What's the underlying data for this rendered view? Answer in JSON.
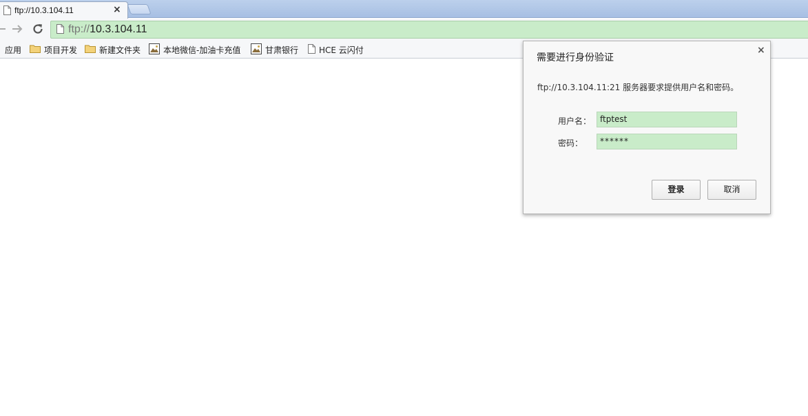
{
  "tab": {
    "title": "ftp://10.3.104.11"
  },
  "omnibox": {
    "scheme": "ftp://",
    "host": "10.3.104.11"
  },
  "bookmarks": [
    {
      "label": "应用",
      "icon": "apps-icon"
    },
    {
      "label": "项目开发",
      "icon": "folder-icon"
    },
    {
      "label": "新建文件夹",
      "icon": "folder-icon"
    },
    {
      "label": "本地微信-加油卡充值",
      "icon": "image-icon"
    },
    {
      "label": "甘肃银行",
      "icon": "image-icon"
    },
    {
      "label": "HCE 云闪付",
      "icon": "page-icon"
    }
  ],
  "dialog": {
    "title": "需要进行身份验证",
    "close": "×",
    "message": "ftp://10.3.104.11:21 服务器要求提供用户名和密码。",
    "username_label": "用户名：",
    "password_label": "密码：",
    "username_value": "ftptest",
    "password_value": "******",
    "login_label": "登录",
    "cancel_label": "取消"
  },
  "colors": {
    "tabstrip": "#a7bfe3",
    "omnibox_bg": "#c9ecc9",
    "dialog_bg": "#f8f8f8",
    "input_bg": "#c9ecc9"
  }
}
